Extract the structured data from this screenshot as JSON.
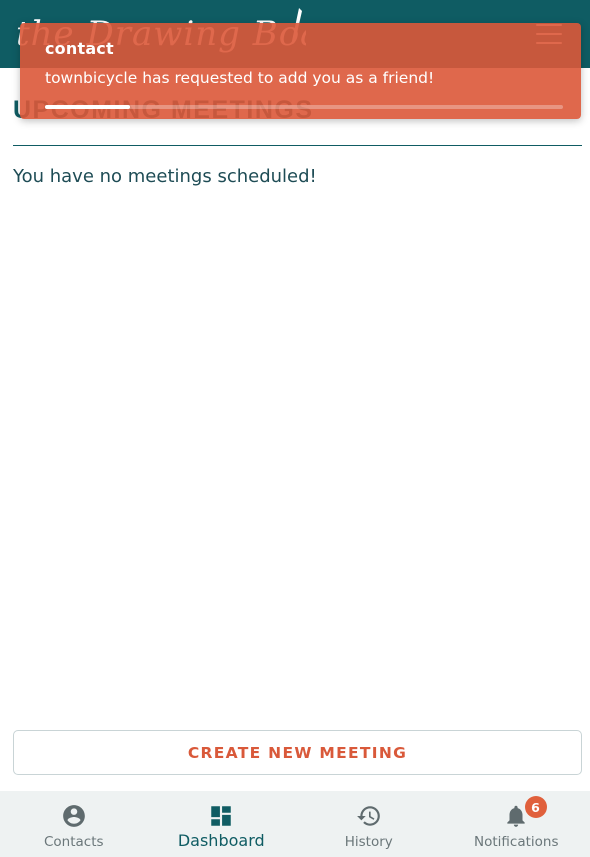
{
  "header": {
    "logo_text": "the Drawing Board",
    "menu_icon": "hamburger-menu-icon"
  },
  "main": {
    "section_title": "UPCOMING MEETINGS",
    "empty_message": "You have no meetings scheduled!",
    "create_button_label": "CREATE NEW MEETING"
  },
  "toast": {
    "title": "contact",
    "message": "townbicycle has requested to add you as a friend!",
    "progress_fraction": 0.165
  },
  "bottom_nav": {
    "items": [
      {
        "label": "Contacts",
        "icon": "account-circle-icon"
      },
      {
        "label": "Dashboard",
        "icon": "dashboard-icon"
      },
      {
        "label": "History",
        "icon": "history-icon"
      },
      {
        "label": "Notifications",
        "icon": "bell-icon",
        "badge": "6"
      }
    ],
    "active_index": 1
  },
  "colors": {
    "brand_teal": "#0f5c63",
    "accent_orange": "#d9593a",
    "toast_background": "#db5838",
    "nav_background": "#eef2f2"
  }
}
